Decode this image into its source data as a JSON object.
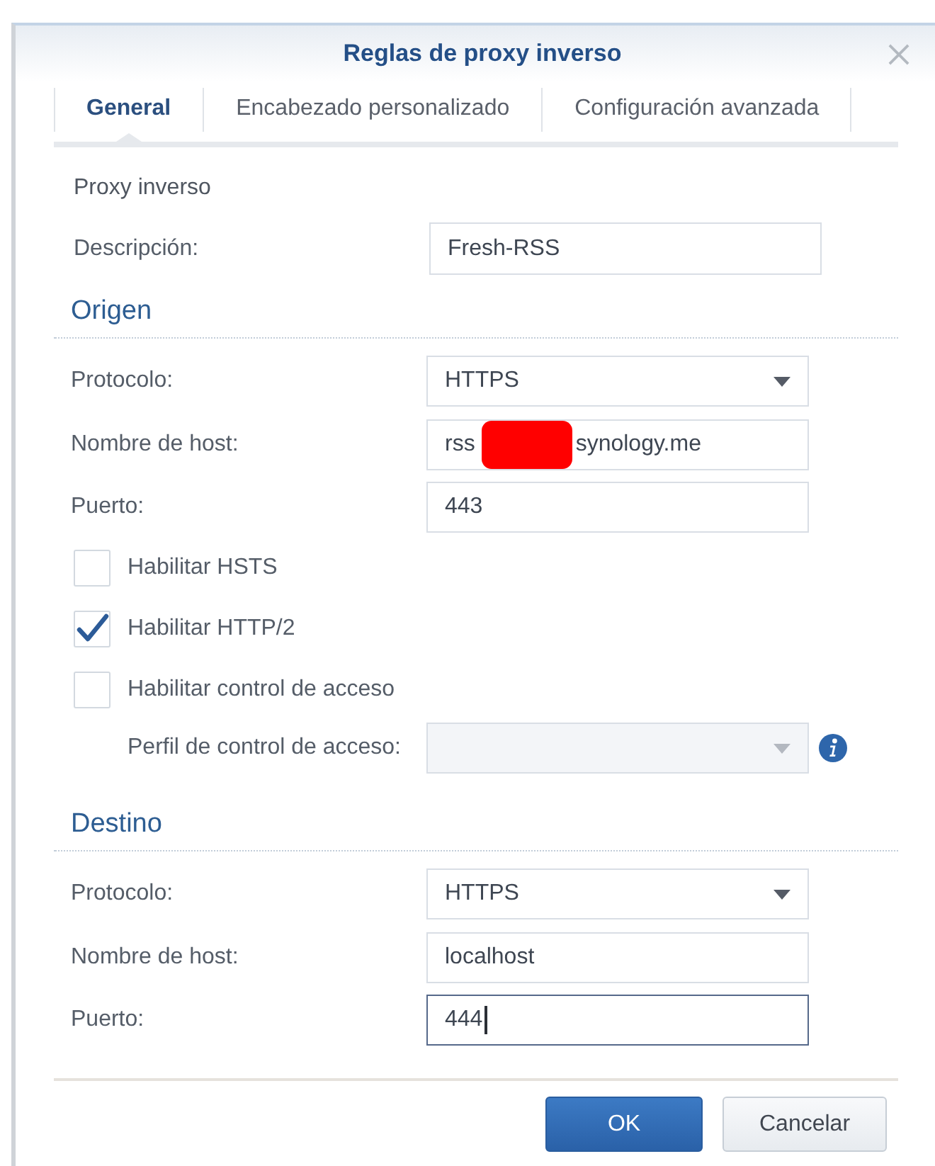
{
  "window": {
    "title": "Reglas de proxy inverso"
  },
  "tabs": [
    {
      "label": "General",
      "selected": true
    },
    {
      "label": "Encabezado personalizado",
      "selected": false
    },
    {
      "label": "Configuración avanzada",
      "selected": false
    }
  ],
  "group_label": "Proxy inverso",
  "description": {
    "label": "Descripción:",
    "value": "Fresh-RSS"
  },
  "sections": [
    {
      "title": "Origen",
      "fields": [
        {
          "kind": "select",
          "label": "Protocolo:",
          "value": "HTTPS",
          "focused": false
        },
        {
          "kind": "redacted",
          "label": "Nombre de host:",
          "value": "rss",
          "value_after": "synology.me",
          "focused": false
        },
        {
          "kind": "text",
          "label": "Puerto:",
          "value": "443",
          "focused": false
        }
      ],
      "options": [
        {
          "label": "Habilitar HSTS",
          "checked": false
        },
        {
          "label": "Habilitar HTTP/2",
          "checked": true
        },
        {
          "label": "Habilitar control de acceso",
          "checked": false
        }
      ],
      "profile": {
        "label": "Perfil de control de acceso:",
        "disabled": true
      }
    },
    {
      "title": "Destino",
      "fields": [
        {
          "kind": "select",
          "label": "Protocolo:",
          "value": "HTTPS",
          "focused": false
        },
        {
          "kind": "text",
          "label": "Nombre de host:",
          "value": "localhost",
          "focused": false
        },
        {
          "kind": "text",
          "label": "Puerto:",
          "value": "444",
          "focused": true
        }
      ]
    }
  ],
  "buttons": [
    {
      "label": "OK",
      "kind": "primary"
    },
    {
      "label": "Cancelar",
      "kind": "secondary"
    }
  ]
}
